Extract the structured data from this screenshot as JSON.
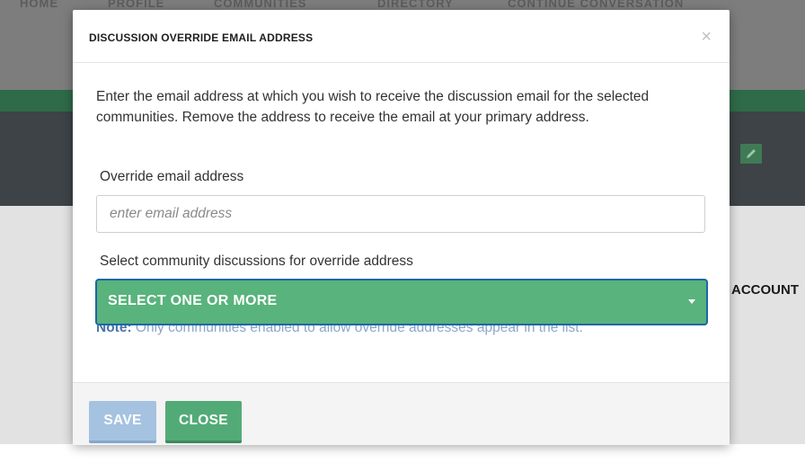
{
  "background": {
    "nav_items": [
      "HOME",
      "PROFILE",
      "COMMUNITIES",
      "DIRECTORY",
      "CONTINUE CONVERSATION"
    ],
    "account_label": "ACCOUNT",
    "edit_icon": "pencil-icon"
  },
  "modal": {
    "title": "DISCUSSION OVERRIDE EMAIL ADDRESS",
    "close_symbol": "×",
    "description": "Enter the email address at which you wish to receive the discussion email for the selected communities. Remove the address to receive the email at your primary address.",
    "override_label": "Override email address",
    "email_input": {
      "value": "",
      "placeholder": "enter email address"
    },
    "select_label": "Select community discussions for override address",
    "select_placeholder": "SELECT ONE OR MORE",
    "note_prefix": "Note:",
    "note_text": " Only communities enabled to allow override addresses appear in the list.",
    "buttons": {
      "save": "SAVE",
      "close": "CLOSE"
    }
  },
  "colors": {
    "accent_green": "#59b37c",
    "focus_blue": "#1f66a6",
    "save_button": "#a5c2e1",
    "close_button": "#52ab76"
  }
}
